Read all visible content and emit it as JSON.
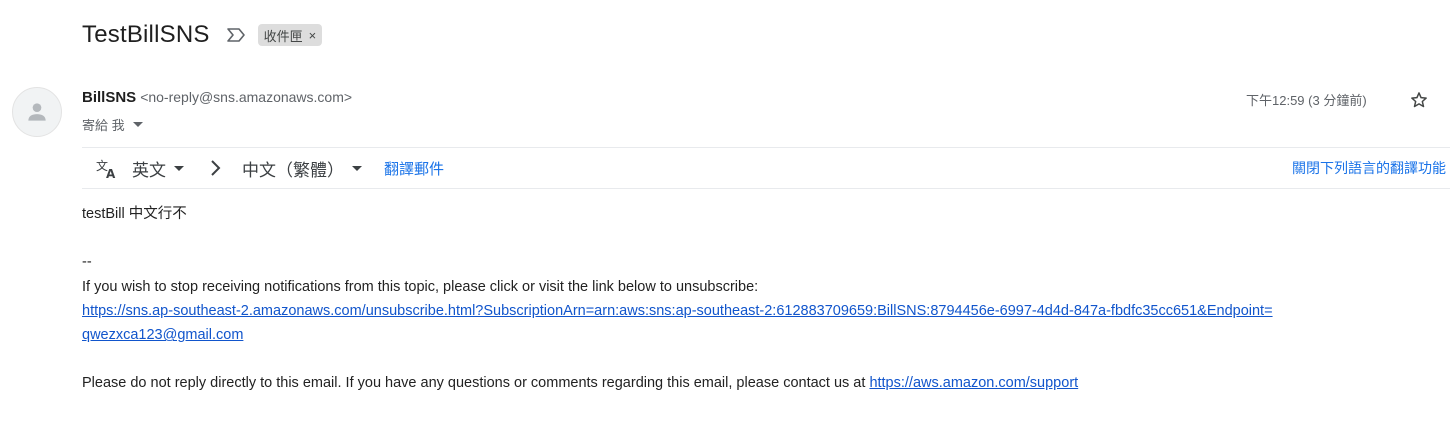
{
  "subject": "TestBillSNS",
  "label": {
    "text": "收件匣",
    "close": "×"
  },
  "sender": {
    "name": "BillSNS",
    "email": "<no-reply@sns.amazonaws.com>",
    "recipient": "寄給 我"
  },
  "timestamp": "下午12:59 (3 分鐘前)",
  "translation": {
    "source_lang": "英文",
    "target_lang": "中文（繁體）",
    "translate_link": "翻譯郵件",
    "turn_off_link": "關閉下列語言的翻譯功能"
  },
  "body": {
    "line1": "testBill 中文行不",
    "separator": "--",
    "unsubscribe_text": "If you wish to stop receiving notifications from this topic, please click or visit the link below to unsubscribe:",
    "unsubscribe_link_part1": "https://sns.ap-southeast-2.amazonaws.com/unsubscribe.html?SubscriptionArn=arn:aws:sns:ap-southeast-2:612883709659:BillSNS:8794456e-6997-4d4d-847a-fbdfc35cc651&Endpoint=",
    "unsubscribe_link_part2": "qwezxca123@gmail.com",
    "footer_text": "Please do not reply directly to this email. If you have any questions or comments regarding this email, please contact us at ",
    "support_link": "https://aws.amazon.com/support"
  },
  "colors": {
    "link": "#1155cc",
    "accent_link": "#1a73e8",
    "chip_bg": "#dddddd"
  }
}
